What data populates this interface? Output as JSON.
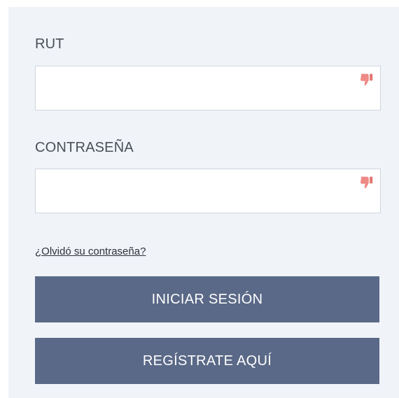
{
  "login_form": {
    "rut": {
      "label": "RUT",
      "value": "",
      "placeholder": "",
      "status_icon": "thumbs-down-icon"
    },
    "password": {
      "label": "CONTRASEÑA",
      "value": "",
      "placeholder": "",
      "status_icon": "thumbs-down-icon"
    },
    "forgot_password_link": "¿Olvidó su contraseña?",
    "login_button": "INICIAR SESIÓN",
    "register_button": "REGÍSTRATE AQUÍ"
  },
  "colors": {
    "panel_background": "#f0f3f8",
    "button_background": "#5a6987",
    "button_text": "#ffffff",
    "status_icon": "#ee8a86"
  }
}
